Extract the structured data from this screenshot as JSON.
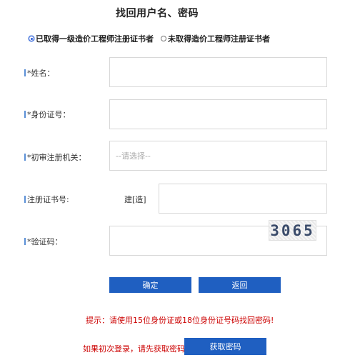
{
  "title": "找回用户名、密码",
  "cert_options": [
    {
      "label": "已取得一级造价工程师注册证书者",
      "checked": true
    },
    {
      "label": "未取得造价工程师注册证书者",
      "checked": false
    }
  ],
  "form": {
    "name_label": "*姓名：",
    "id_label": "*身份证号：",
    "authority_label": "*初审注册机关：",
    "authority_placeholder": "--请选择--",
    "cert_no_label": "注册证书号:",
    "cert_no_prefix": "建[造]",
    "captcha_label": "*验证码：",
    "captcha_text": "3065"
  },
  "buttons": {
    "confirm": "确定",
    "back": "返回",
    "get_password": "获取密码"
  },
  "hints": {
    "tip": "提示：请使用15位身份证或18位身份证号码找回密码!",
    "first_login": "如果初次登录，请先获取密码!"
  },
  "colors": {
    "accent": "#1f5fc1",
    "hint": "#cc0000",
    "label_bar": "#5a8fd6"
  }
}
